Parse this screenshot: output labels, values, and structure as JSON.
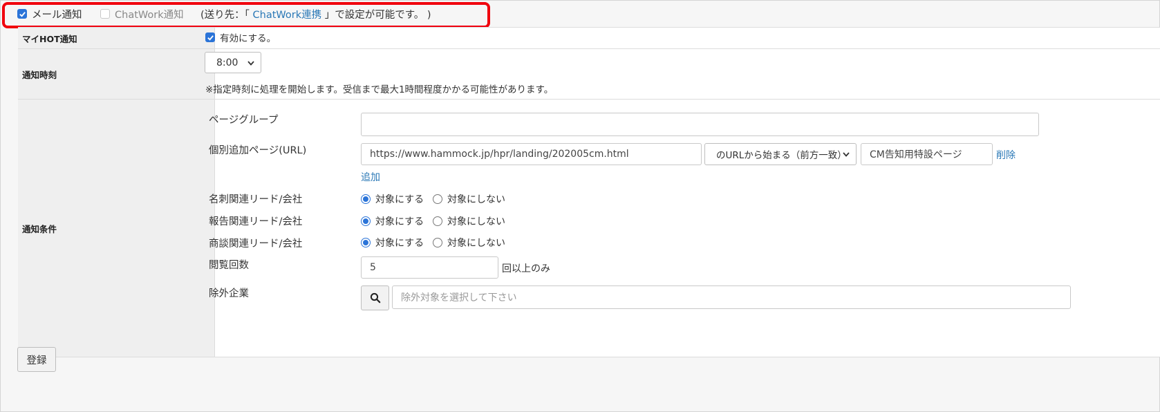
{
  "top": {
    "mail_notify_label": "メール通知",
    "mail_notify_checked": true,
    "chatwork_notify_label": "ChatWork通知",
    "chatwork_notify_checked": false,
    "note_prefix": "(送り先：「",
    "chatwork_link": "ChatWork連携",
    "note_suffix": "」で設定が可能です。 )"
  },
  "rows": {
    "my_hot": {
      "header": "マイHOT通知",
      "enable_label": "有効にする。",
      "enabled": true
    },
    "time": {
      "header": "通知時刻",
      "selected": "8:00",
      "note": "※指定時刻に処理を開始します。受信まで最大1時間程度かかる可能性があります。"
    },
    "conditions": {
      "header": "通知条件",
      "page_group": {
        "label": "ページグループ",
        "value": ""
      },
      "individual": {
        "label": "個別追加ページ(URL)",
        "url": "https://www.hammock.jp/hpr/landing/202005cm.html",
        "match": "のURLから始まる（前方一致）",
        "page_name": "CM告知用特設ページ",
        "delete": "削除",
        "add": "追加"
      },
      "radio_groups": [
        {
          "label": "名刺関連リード/会社",
          "yes": "対象にする",
          "no": "対象にしない",
          "selected": "yes"
        },
        {
          "label": "報告関連リード/会社",
          "yes": "対象にする",
          "no": "対象にしない",
          "selected": "yes"
        },
        {
          "label": "商談関連リード/会社",
          "yes": "対象にする",
          "no": "対象にしない",
          "selected": "yes"
        }
      ],
      "views": {
        "label": "閲覧回数",
        "value": "5",
        "suffix": "回以上のみ"
      },
      "exclude": {
        "label": "除外企業",
        "placeholder": "除外対象を選択して下さい"
      }
    }
  },
  "footer": {
    "register_label": "登録"
  },
  "colors": {
    "accent": "#2b74d8",
    "highlight": "#f0000d",
    "link": "#2a78b6"
  },
  "icons": {
    "search": "search-icon",
    "check": "check-icon",
    "chevron": "chevron-down-icon"
  }
}
